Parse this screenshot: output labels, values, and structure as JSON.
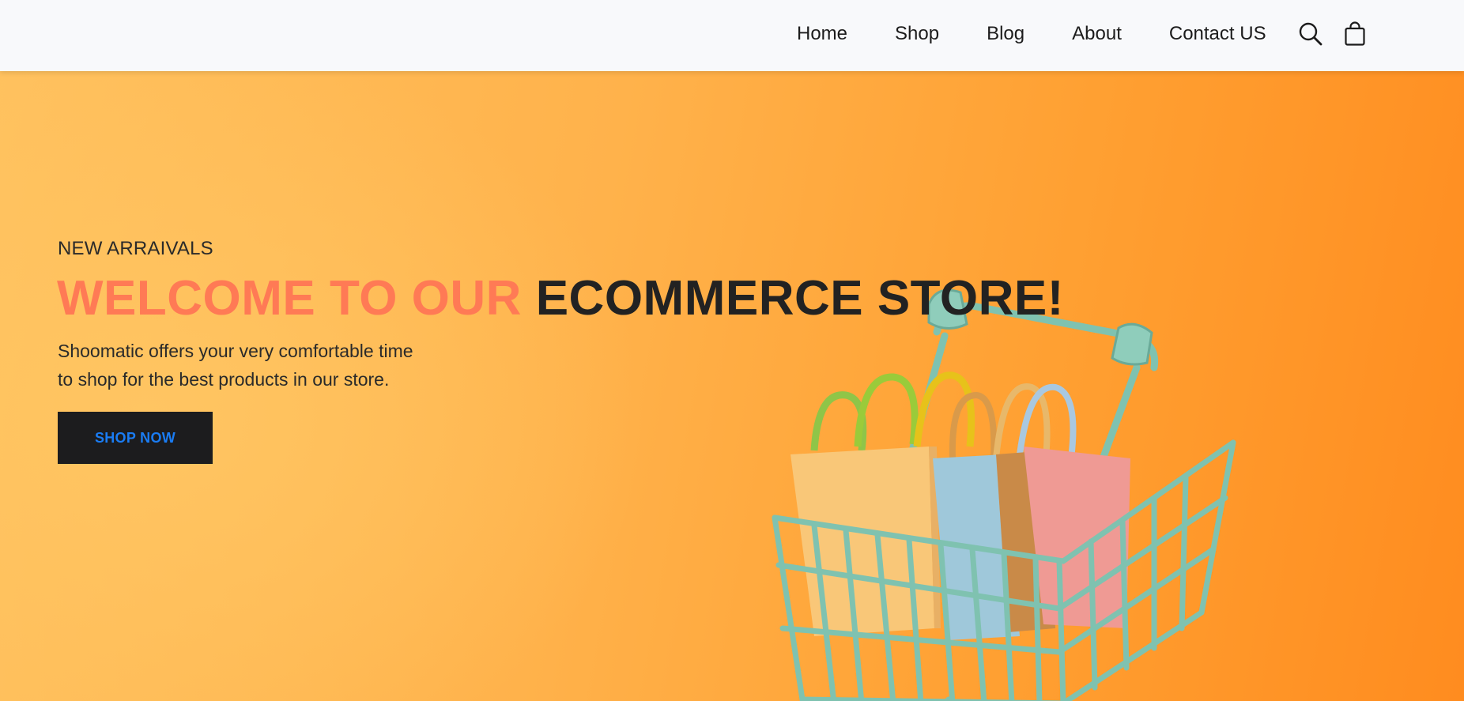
{
  "nav": {
    "links": [
      "Home",
      "Shop",
      "Blog",
      "About",
      "Contact US"
    ],
    "icons": [
      "search-icon",
      "shopping-bag-icon"
    ]
  },
  "hero": {
    "kicker": "NEW ARRAIVALS",
    "headline_accent": "WELCOME TO OUR",
    "headline_dark": "ECOMMERCE STORE!",
    "description_line1": "Shoomatic offers your very comfortable time",
    "description_line2": "to shop for the best products in our store.",
    "cta_label": "SHOP NOW"
  },
  "colors": {
    "nav_bg": "#f8f9fb",
    "hero_orange": "#ffa64a",
    "accent_coral": "#ff7a55",
    "dark_text": "#222222",
    "button_bg": "#1c1c1e",
    "button_text": "#1a7cf3",
    "cart_teal": "#7fc2b0"
  }
}
